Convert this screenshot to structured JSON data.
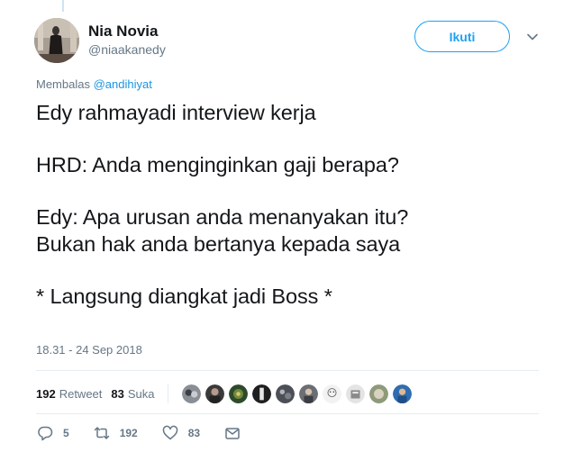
{
  "tweet": {
    "author": {
      "name": "Nia Novia",
      "handle": "@niaakanedy"
    },
    "follow_label": "Ikuti",
    "reply_prefix": "Membalas",
    "reply_mention": "@andihiyat",
    "lines": [
      "Edy rahmayadi interview kerja",
      "HRD: Anda menginginkan gaji berapa?",
      "Edy: Apa urusan anda menanyakan itu?",
      "Bukan hak anda bertanya kepada saya",
      "* Langsung diangkat jadi Boss *"
    ],
    "timestamp": "18.31 - 24 Sep 2018",
    "stats": {
      "retweet_count": "192",
      "retweet_label": "Retweet",
      "like_count": "83",
      "like_label": "Suka"
    },
    "actions": {
      "reply_count": "5",
      "retweet_count": "192",
      "like_count": "83"
    }
  },
  "icons": [
    "chevron-down-icon",
    "reply-icon",
    "retweet-icon",
    "heart-icon",
    "message-icon"
  ],
  "colors": {
    "accent": "#1da1f2",
    "mention": "#1b95e0",
    "secondary_text": "#657786",
    "divider": "#e6ecf0"
  }
}
